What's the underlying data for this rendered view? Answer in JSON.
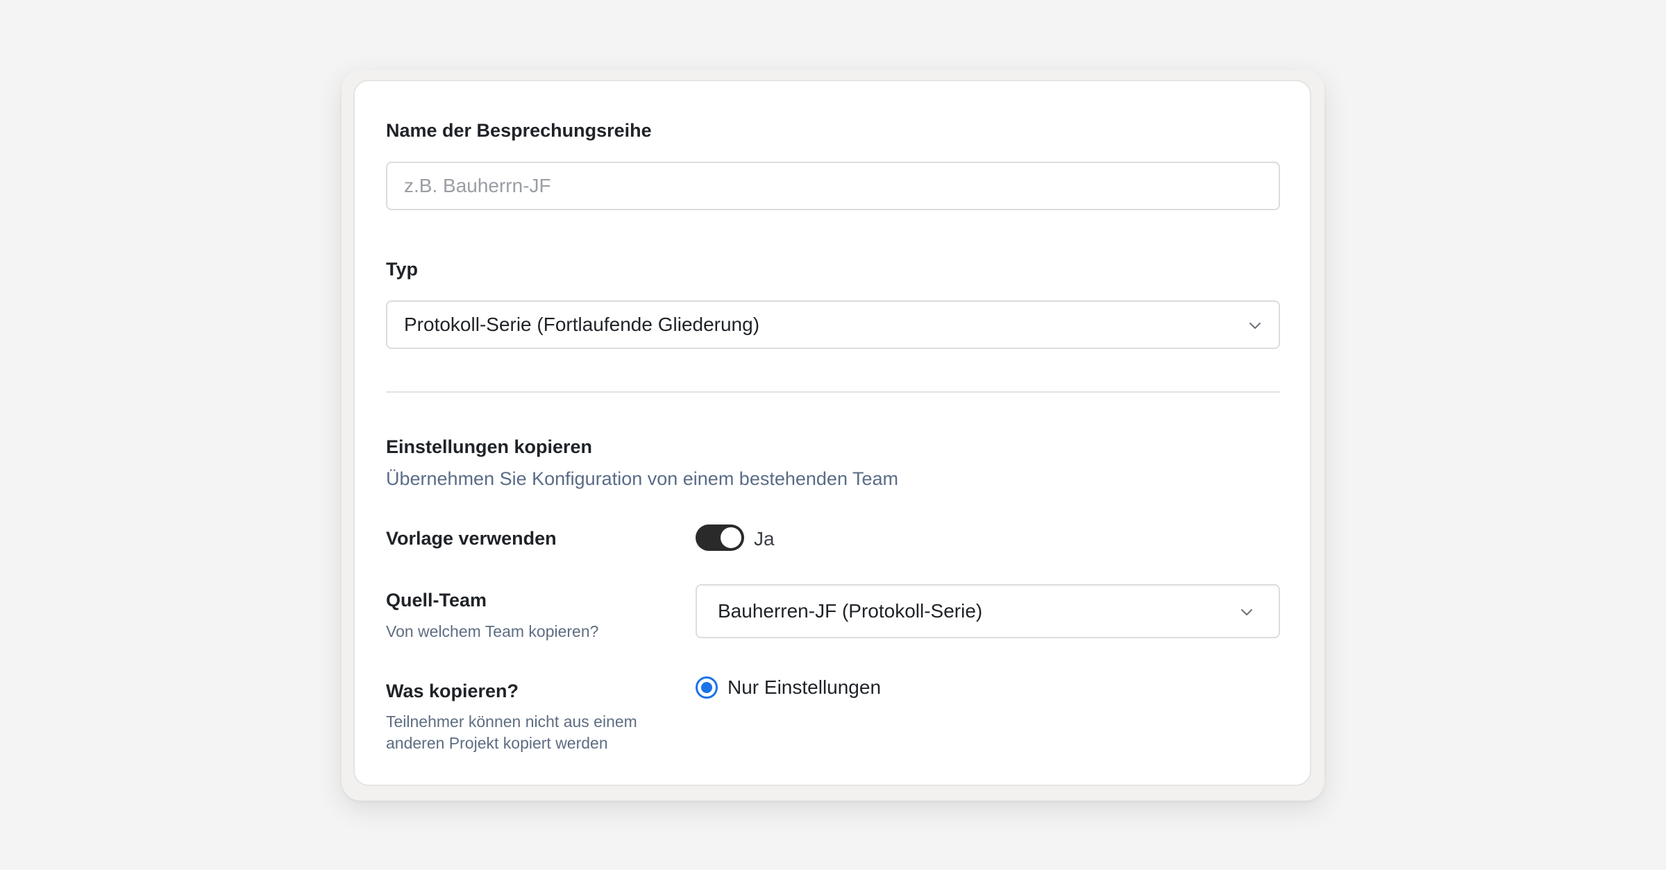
{
  "form": {
    "name_label": "Name der Besprechungsreihe",
    "name_placeholder": "z.B. Bauherrn-JF",
    "name_value": "",
    "type_label": "Typ",
    "type_value": "Protokoll-Serie (Fortlaufende Gliederung)"
  },
  "copy_settings": {
    "heading": "Einstellungen kopieren",
    "description": "Übernehmen Sie Konfiguration von einem bestehenden Team",
    "use_template_label": "Vorlage verwenden",
    "use_template_state": "Ja",
    "use_template_on": true,
    "source_team_label": "Quell-Team",
    "source_team_hint": "Von welchem Team kopieren?",
    "source_team_value": "Bauherren-JF (Protokoll-Serie)",
    "what_copy_label": "Was kopieren?",
    "what_copy_hint": "Teilnehmer können nicht aus einem anderen Projekt kopiert werden",
    "what_copy_option": "Nur Einstellungen"
  },
  "colors": {
    "accent": "#1a73e8",
    "toggle_on": "#2a2a2a",
    "hint_text": "#5e6d82"
  },
  "icons": {
    "dropdown": "chevron-down-icon"
  }
}
